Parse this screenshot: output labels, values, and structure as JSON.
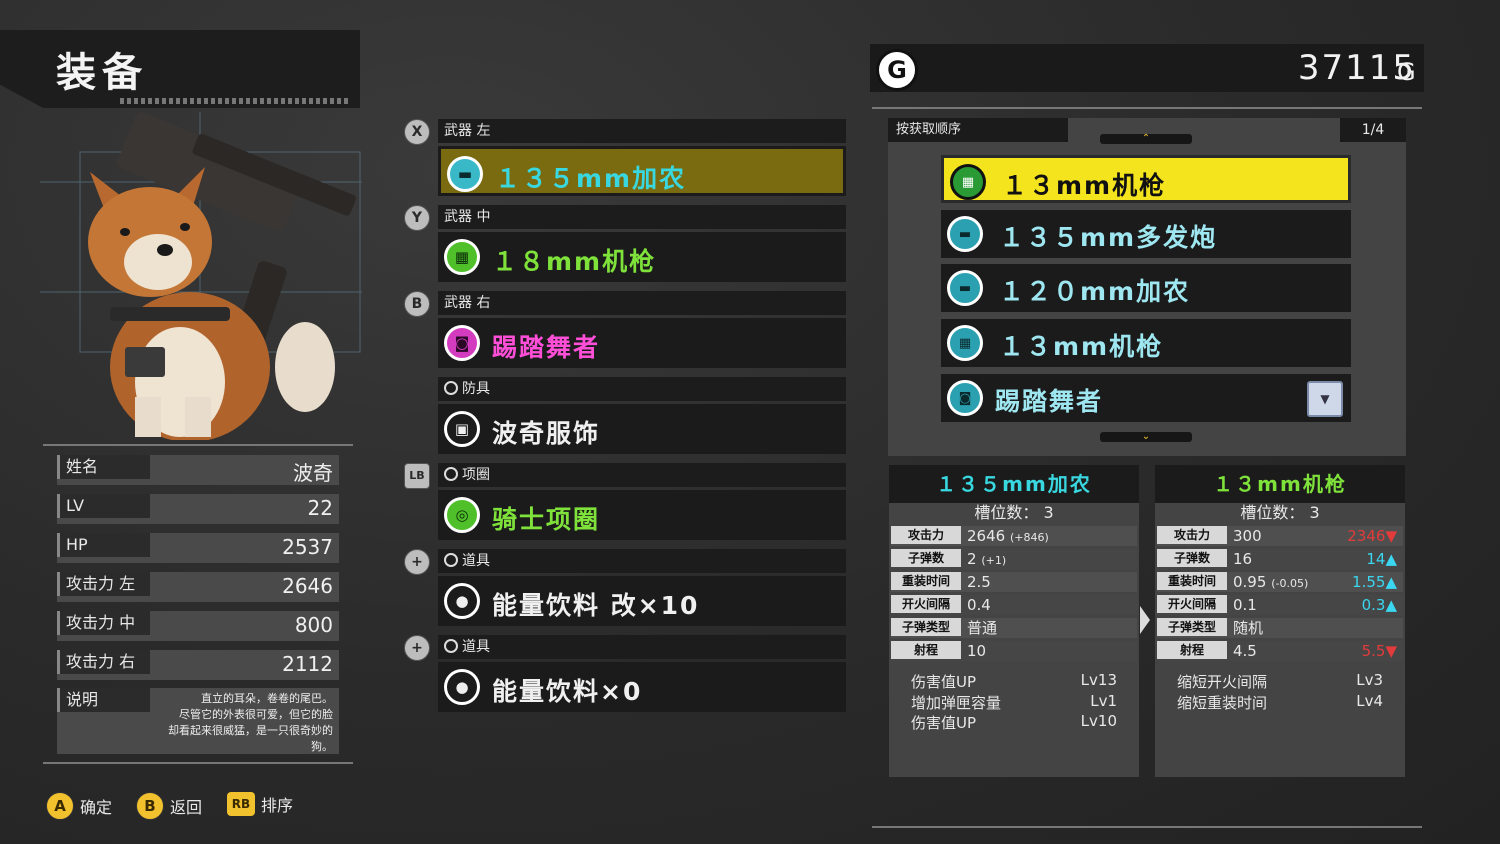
{
  "header": {
    "title": "装备"
  },
  "character": {
    "stats": [
      {
        "label": "姓名",
        "value": "波奇"
      },
      {
        "label": "LV",
        "value": "22"
      },
      {
        "label": "HP",
        "value": "2537"
      },
      {
        "label": "攻击力 左",
        "value": "2646"
      },
      {
        "label": "攻击力 中",
        "value": "800"
      },
      {
        "label": "攻击力 右",
        "value": "2112"
      }
    ],
    "desc_label": "说明",
    "desc_lines": [
      "直立的耳朵，卷卷的尾巴。",
      "尽管它的外表很可爱，但它的脸",
      "却看起来很威猛，是一只很奇妙的",
      "狗。"
    ]
  },
  "footer": [
    {
      "button": "A",
      "label": "确定"
    },
    {
      "button": "B",
      "label": "返回"
    },
    {
      "button": "RB",
      "label": "排序"
    }
  ],
  "slots": [
    {
      "button": "X",
      "header": "武器 左",
      "name": "１３５mm加农",
      "icon": "cannon-icon",
      "color": "#39d8e0",
      "selected": true
    },
    {
      "button": "Y",
      "header": "武器 中",
      "name": "１８mm机枪",
      "icon": "machine-gun-icon",
      "color": "#7fe23b",
      "selected": false
    },
    {
      "button": "B",
      "header": "武器 右",
      "name": "踢踏舞者",
      "icon": "dancer-icon",
      "color": "#ff4fd8",
      "selected": false
    },
    {
      "button": "",
      "header": "防具",
      "name": "波奇服饰",
      "icon": "armor-icon",
      "color": "#f0f0f0",
      "selected": false
    },
    {
      "button": "LB",
      "header": "项圈",
      "name": "骑士项圈",
      "icon": "collar-icon",
      "color": "#7fe23b",
      "selected": false
    },
    {
      "button": "+",
      "header": "道具",
      "name": "能量饮料 改×10",
      "icon": "item-icon",
      "color": "#f0f0f0",
      "selected": false
    },
    {
      "button": "+",
      "header": "道具",
      "name": "能量饮料×0",
      "icon": "item-icon",
      "color": "#f0f0f0",
      "selected": false
    }
  ],
  "gold": {
    "icon": "G",
    "value": "37115",
    "unit": "G"
  },
  "list": {
    "sort_label": "按获取顺序",
    "page": "1/4",
    "items": [
      {
        "name": "１３mm机枪",
        "icon": "machine-gun-icon",
        "selected": true
      },
      {
        "name": "１３５mm多发炮",
        "icon": "cannon-icon",
        "selected": false
      },
      {
        "name": "１２０mm加农",
        "icon": "cannon-icon",
        "selected": false
      },
      {
        "name": "１３mm机枪",
        "icon": "machine-gun-icon",
        "selected": false
      },
      {
        "name": "踢踏舞者",
        "icon": "dancer-icon",
        "selected": false,
        "badge": "dog-badge"
      }
    ]
  },
  "compare": [
    {
      "name": "１３５mm加农",
      "slots": "槽位数： 3",
      "rows": [
        {
          "label": "攻击力",
          "value": "2646",
          "extra": "(+846)",
          "diff": "",
          "dir": ""
        },
        {
          "label": "子弹数",
          "value": "2",
          "extra": "(+1)",
          "diff": "",
          "dir": ""
        },
        {
          "label": "重装时间",
          "value": "2.5",
          "extra": "",
          "diff": "",
          "dir": ""
        },
        {
          "label": "开火间隔",
          "value": "0.4",
          "extra": "",
          "diff": "",
          "dir": ""
        },
        {
          "label": "子弹类型",
          "value": "普通",
          "extra": "",
          "diff": "",
          "dir": ""
        },
        {
          "label": "射程",
          "value": "10",
          "extra": "",
          "diff": "",
          "dir": ""
        }
      ],
      "skills": [
        {
          "name": "伤害值UP",
          "lv": "Lv13"
        },
        {
          "name": "增加弹匣容量",
          "lv": "Lv1"
        },
        {
          "name": "伤害值UP",
          "lv": "Lv10"
        }
      ]
    },
    {
      "name": "１３mm机枪",
      "slots": "槽位数： 3",
      "rows": [
        {
          "label": "攻击力",
          "value": "300",
          "extra": "",
          "diff": "2346",
          "dir": "down"
        },
        {
          "label": "子弹数",
          "value": "16",
          "extra": "",
          "diff": "14",
          "dir": "up"
        },
        {
          "label": "重装时间",
          "value": "0.95",
          "extra": "(-0.05)",
          "diff": "1.55",
          "dir": "up"
        },
        {
          "label": "开火间隔",
          "value": "0.1",
          "extra": "",
          "diff": "0.3",
          "dir": "up"
        },
        {
          "label": "子弹类型",
          "value": "随机",
          "extra": "",
          "diff": "",
          "dir": ""
        },
        {
          "label": "射程",
          "value": "4.5",
          "extra": "",
          "diff": "5.5",
          "dir": "down"
        }
      ],
      "skills": [
        {
          "name": "缩短开火间隔",
          "lv": "Lv3"
        },
        {
          "name": "缩短重装时间",
          "lv": "Lv4"
        }
      ]
    }
  ]
}
